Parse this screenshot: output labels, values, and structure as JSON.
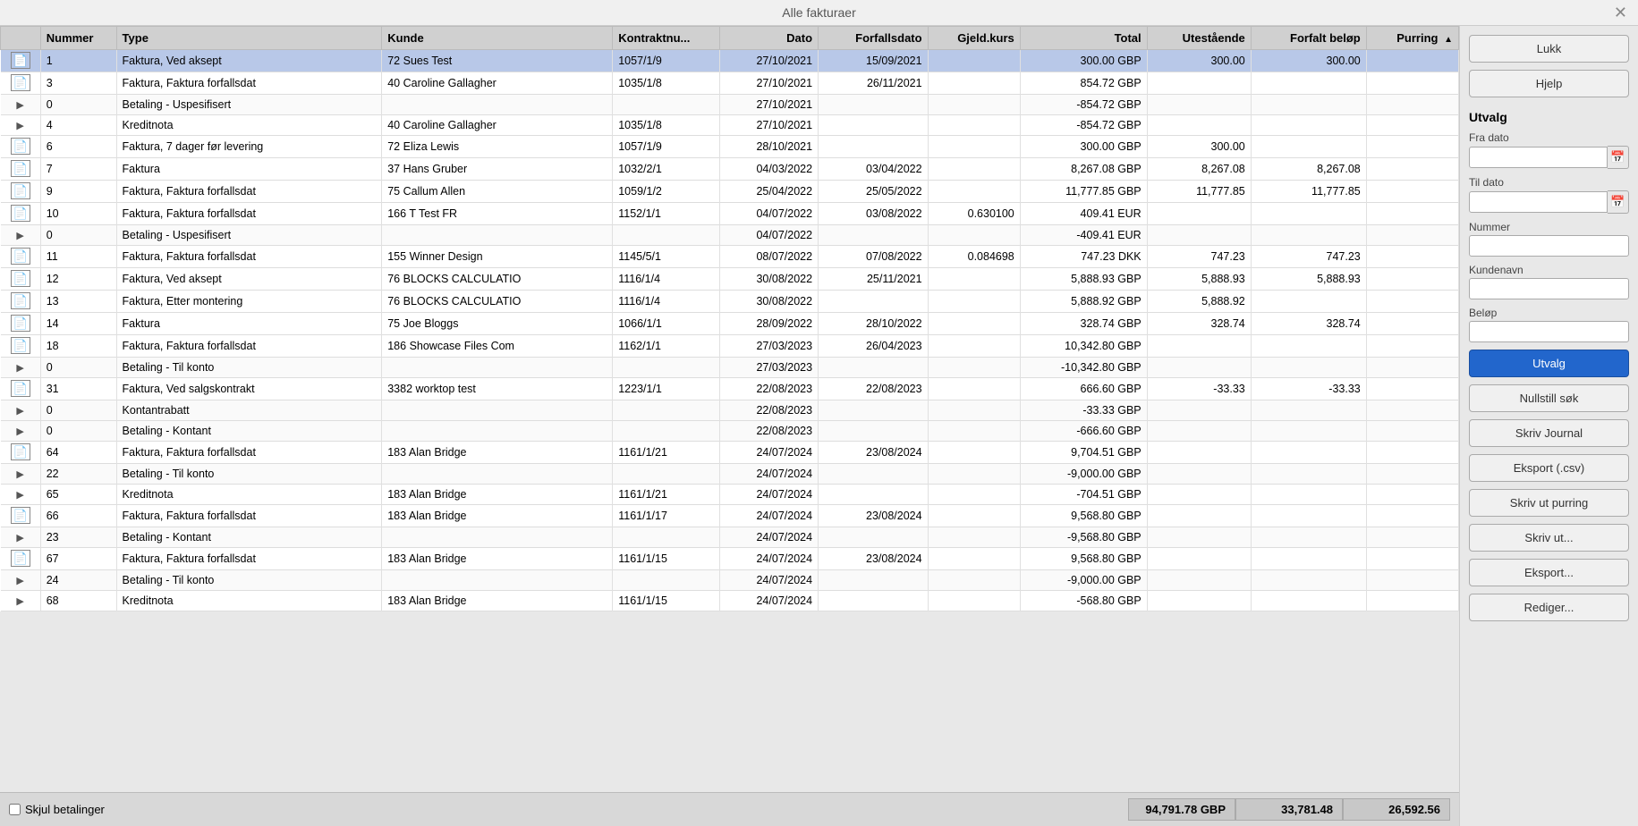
{
  "title": "Alle fakturaer",
  "close_label": "×",
  "columns": [
    {
      "id": "expand",
      "label": "",
      "align": "left"
    },
    {
      "id": "nummer",
      "label": "Nummer",
      "align": "left"
    },
    {
      "id": "type",
      "label": "Type",
      "align": "left"
    },
    {
      "id": "kunde",
      "label": "Kunde",
      "align": "left"
    },
    {
      "id": "kontraktnu",
      "label": "Kontraktnu...",
      "align": "left"
    },
    {
      "id": "dato",
      "label": "Dato",
      "align": "right"
    },
    {
      "id": "forfallsdato",
      "label": "Forfallsdato",
      "align": "right"
    },
    {
      "id": "gjeldkurs",
      "label": "Gjeld.kurs",
      "align": "right"
    },
    {
      "id": "total",
      "label": "Total",
      "align": "right"
    },
    {
      "id": "utestående",
      "label": "Utestående",
      "align": "right"
    },
    {
      "id": "forfalt_belop",
      "label": "Forfalt beløp",
      "align": "right"
    },
    {
      "id": "purring",
      "label": "Purring",
      "align": "right",
      "sort": "asc"
    }
  ],
  "rows": [
    {
      "expand": "doc",
      "nummer": "1",
      "type": "Faktura, Ved aksept",
      "kunde": "72 Sues Test",
      "kontraktnu": "1057/1/9",
      "dato": "27/10/2021",
      "forfallsdato": "15/09/2021",
      "gjeldkurs": "",
      "total": "300.00 GBP",
      "utestående": "300.00",
      "forfalt_belop": "300.00",
      "purring": "",
      "selected": true
    },
    {
      "expand": "doc",
      "nummer": "3",
      "type": "Faktura, Faktura forfallsdat",
      "kunde": "40 Caroline Gallagher",
      "kontraktnu": "1035/1/8",
      "dato": "27/10/2021",
      "forfallsdato": "26/11/2021",
      "gjeldkurs": "",
      "total": "854.72 GBP",
      "utestående": "",
      "forfalt_belop": "",
      "purring": "",
      "selected": false
    },
    {
      "expand": "arrow",
      "nummer": "0",
      "type": "Betaling - Uspesifisert",
      "kunde": "",
      "kontraktnu": "",
      "dato": "27/10/2021",
      "forfallsdato": "",
      "gjeldkurs": "",
      "total": "-854.72 GBP",
      "utestående": "",
      "forfalt_belop": "",
      "purring": "",
      "selected": false,
      "sub": true
    },
    {
      "expand": "arrow",
      "nummer": "4",
      "type": "Kreditnota",
      "kunde": "40 Caroline Gallagher",
      "kontraktnu": "1035/1/8",
      "dato": "27/10/2021",
      "forfallsdato": "",
      "gjeldkurs": "",
      "total": "-854.72 GBP",
      "utestående": "",
      "forfalt_belop": "",
      "purring": "",
      "selected": false
    },
    {
      "expand": "doc",
      "nummer": "6",
      "type": "Faktura, 7 dager før levering",
      "kunde": "72 Eliza Lewis",
      "kontraktnu": "1057/1/9",
      "dato": "28/10/2021",
      "forfallsdato": "",
      "gjeldkurs": "",
      "total": "300.00 GBP",
      "utestående": "300.00",
      "forfalt_belop": "",
      "purring": "",
      "selected": false
    },
    {
      "expand": "doc",
      "nummer": "7",
      "type": "Faktura",
      "kunde": "37 Hans Gruber",
      "kontraktnu": "1032/2/1",
      "dato": "04/03/2022",
      "forfallsdato": "03/04/2022",
      "gjeldkurs": "",
      "total": "8,267.08 GBP",
      "utestående": "8,267.08",
      "forfalt_belop": "8,267.08",
      "purring": "",
      "selected": false
    },
    {
      "expand": "doc",
      "nummer": "9",
      "type": "Faktura, Faktura forfallsdat",
      "kunde": "75 Callum Allen",
      "kontraktnu": "1059/1/2",
      "dato": "25/04/2022",
      "forfallsdato": "25/05/2022",
      "gjeldkurs": "",
      "total": "11,777.85 GBP",
      "utestående": "11,777.85",
      "forfalt_belop": "11,777.85",
      "purring": "",
      "selected": false
    },
    {
      "expand": "doc",
      "nummer": "10",
      "type": "Faktura, Faktura forfallsdat",
      "kunde": "166 T Test FR",
      "kontraktnu": "1152/1/1",
      "dato": "04/07/2022",
      "forfallsdato": "03/08/2022",
      "gjeldkurs": "0.630100",
      "total": "409.41 EUR",
      "utestående": "",
      "forfalt_belop": "",
      "purring": "",
      "selected": false
    },
    {
      "expand": "arrow",
      "nummer": "0",
      "type": "Betaling - Uspesifisert",
      "kunde": "",
      "kontraktnu": "",
      "dato": "04/07/2022",
      "forfallsdato": "",
      "gjeldkurs": "",
      "total": "-409.41 EUR",
      "utestående": "",
      "forfalt_belop": "",
      "purring": "",
      "selected": false,
      "sub": true
    },
    {
      "expand": "doc",
      "nummer": "11",
      "type": "Faktura, Faktura forfallsdat",
      "kunde": "155 Winner Design",
      "kontraktnu": "1145/5/1",
      "dato": "08/07/2022",
      "forfallsdato": "07/08/2022",
      "gjeldkurs": "0.084698",
      "total": "747.23 DKK",
      "utestående": "747.23",
      "forfalt_belop": "747.23",
      "purring": "",
      "selected": false
    },
    {
      "expand": "doc",
      "nummer": "12",
      "type": "Faktura, Ved aksept",
      "kunde": "76 BLOCKS CALCULATIO",
      "kontraktnu": "1116/1/4",
      "dato": "30/08/2022",
      "forfallsdato": "25/11/2021",
      "gjeldkurs": "",
      "total": "5,888.93 GBP",
      "utestående": "5,888.93",
      "forfalt_belop": "5,888.93",
      "purring": "",
      "selected": false
    },
    {
      "expand": "doc",
      "nummer": "13",
      "type": "Faktura, Etter montering",
      "kunde": "76 BLOCKS CALCULATIO",
      "kontraktnu": "1116/1/4",
      "dato": "30/08/2022",
      "forfallsdato": "",
      "gjeldkurs": "",
      "total": "5,888.92 GBP",
      "utestående": "5,888.92",
      "forfalt_belop": "",
      "purring": "",
      "selected": false
    },
    {
      "expand": "doc",
      "nummer": "14",
      "type": "Faktura",
      "kunde": "75 Joe Bloggs",
      "kontraktnu": "1066/1/1",
      "dato": "28/09/2022",
      "forfallsdato": "28/10/2022",
      "gjeldkurs": "",
      "total": "328.74 GBP",
      "utestående": "328.74",
      "forfalt_belop": "328.74",
      "purring": "",
      "selected": false
    },
    {
      "expand": "doc",
      "nummer": "18",
      "type": "Faktura, Faktura forfallsdat",
      "kunde": "186 Showcase Files Com",
      "kontraktnu": "1162/1/1",
      "dato": "27/03/2023",
      "forfallsdato": "26/04/2023",
      "gjeldkurs": "",
      "total": "10,342.80 GBP",
      "utestående": "",
      "forfalt_belop": "",
      "purring": "",
      "selected": false
    },
    {
      "expand": "arrow",
      "nummer": "0",
      "type": "Betaling - Til konto",
      "kunde": "",
      "kontraktnu": "",
      "dato": "27/03/2023",
      "forfallsdato": "",
      "gjeldkurs": "",
      "total": "-10,342.80 GBP",
      "utestående": "",
      "forfalt_belop": "",
      "purring": "",
      "selected": false,
      "sub": true
    },
    {
      "expand": "doc",
      "nummer": "31",
      "type": "Faktura, Ved salgskontrakt",
      "kunde": "3382 worktop test",
      "kontraktnu": "1223/1/1",
      "dato": "22/08/2023",
      "forfallsdato": "22/08/2023",
      "gjeldkurs": "",
      "total": "666.60 GBP",
      "utestående": "-33.33",
      "forfalt_belop": "-33.33",
      "purring": "",
      "selected": false
    },
    {
      "expand": "arrow",
      "nummer": "0",
      "type": "Kontantrabatt",
      "kunde": "",
      "kontraktnu": "",
      "dato": "22/08/2023",
      "forfallsdato": "",
      "gjeldkurs": "",
      "total": "-33.33 GBP",
      "utestående": "",
      "forfalt_belop": "",
      "purring": "",
      "selected": false,
      "sub": true
    },
    {
      "expand": "arrow",
      "nummer": "0",
      "type": "Betaling - Kontant",
      "kunde": "",
      "kontraktnu": "",
      "dato": "22/08/2023",
      "forfallsdato": "",
      "gjeldkurs": "",
      "total": "-666.60 GBP",
      "utestående": "",
      "forfalt_belop": "",
      "purring": "",
      "selected": false,
      "sub": true
    },
    {
      "expand": "doc",
      "nummer": "64",
      "type": "Faktura, Faktura forfallsdat",
      "kunde": "183 Alan Bridge",
      "kontraktnu": "1161/1/21",
      "dato": "24/07/2024",
      "forfallsdato": "23/08/2024",
      "gjeldkurs": "",
      "total": "9,704.51 GBP",
      "utestående": "",
      "forfalt_belop": "",
      "purring": "",
      "selected": false
    },
    {
      "expand": "arrow",
      "nummer": "22",
      "type": "Betaling - Til konto",
      "kunde": "",
      "kontraktnu": "",
      "dato": "24/07/2024",
      "forfallsdato": "",
      "gjeldkurs": "",
      "total": "-9,000.00 GBP",
      "utestående": "",
      "forfalt_belop": "",
      "purring": "",
      "selected": false,
      "sub": true
    },
    {
      "expand": "arrow",
      "nummer": "65",
      "type": "Kreditnota",
      "kunde": "183 Alan Bridge",
      "kontraktnu": "1161/1/21",
      "dato": "24/07/2024",
      "forfallsdato": "",
      "gjeldkurs": "",
      "total": "-704.51 GBP",
      "utestående": "",
      "forfalt_belop": "",
      "purring": "",
      "selected": false
    },
    {
      "expand": "doc",
      "nummer": "66",
      "type": "Faktura, Faktura forfallsdat",
      "kunde": "183 Alan Bridge",
      "kontraktnu": "1161/1/17",
      "dato": "24/07/2024",
      "forfallsdato": "23/08/2024",
      "gjeldkurs": "",
      "total": "9,568.80 GBP",
      "utestående": "",
      "forfalt_belop": "",
      "purring": "",
      "selected": false
    },
    {
      "expand": "arrow",
      "nummer": "23",
      "type": "Betaling - Kontant",
      "kunde": "",
      "kontraktnu": "",
      "dato": "24/07/2024",
      "forfallsdato": "",
      "gjeldkurs": "",
      "total": "-9,568.80 GBP",
      "utestående": "",
      "forfalt_belop": "",
      "purring": "",
      "selected": false,
      "sub": true
    },
    {
      "expand": "doc",
      "nummer": "67",
      "type": "Faktura, Faktura forfallsdat",
      "kunde": "183 Alan Bridge",
      "kontraktnu": "1161/1/15",
      "dato": "24/07/2024",
      "forfallsdato": "23/08/2024",
      "gjeldkurs": "",
      "total": "9,568.80 GBP",
      "utestående": "",
      "forfalt_belop": "",
      "purring": "",
      "selected": false
    },
    {
      "expand": "arrow",
      "nummer": "24",
      "type": "Betaling - Til konto",
      "kunde": "",
      "kontraktnu": "",
      "dato": "24/07/2024",
      "forfallsdato": "",
      "gjeldkurs": "",
      "total": "-9,000.00 GBP",
      "utestående": "",
      "forfalt_belop": "",
      "purring": "",
      "selected": false,
      "sub": true
    },
    {
      "expand": "arrow",
      "nummer": "68",
      "type": "Kreditnota",
      "kunde": "183 Alan Bridge",
      "kontraktnu": "1161/1/15",
      "dato": "24/07/2024",
      "forfallsdato": "",
      "gjeldkurs": "",
      "total": "-568.80 GBP",
      "utestående": "",
      "forfalt_belop": "",
      "purring": "",
      "selected": false
    }
  ],
  "footer": {
    "checkbox_label": "Skjul betalinger",
    "total1": "94,791.78 GBP",
    "total2": "33,781.48",
    "total3": "26,592.56"
  },
  "right_panel": {
    "btn_lukk": "Lukk",
    "btn_hjelp": "Hjelp",
    "section_utvalg": "Utvalg",
    "label_fra_dato": "Fra dato",
    "label_til_dato": "Til dato",
    "label_nummer": "Nummer",
    "label_kundenavn": "Kundenavn",
    "label_belop": "Beløp",
    "btn_utvalg": "Utvalg",
    "btn_nullstill": "Nullstill søk",
    "btn_skriv_journal": "Skriv Journal",
    "btn_eksport_csv": "Eksport (.csv)",
    "btn_skriv_purring": "Skriv ut purring",
    "btn_skriv_ut": "Skriv ut...",
    "btn_eksport": "Eksport...",
    "btn_rediger": "Rediger..."
  }
}
